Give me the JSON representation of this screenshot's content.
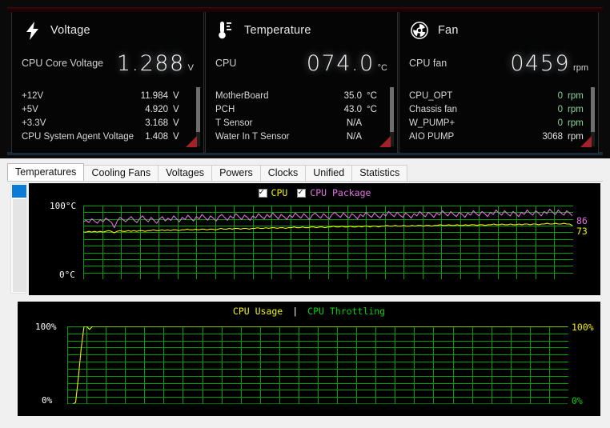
{
  "hw_monitor": {
    "panels": [
      {
        "id": "voltage",
        "icon": "lightning-bolt-icon",
        "title": "Voltage",
        "primary": {
          "label": "CPU Core Voltage",
          "value": "1.288",
          "unit": "V"
        },
        "rows": [
          {
            "name": "+12V",
            "value": "11.984",
            "unit": "V"
          },
          {
            "name": "+5V",
            "value": "4.920",
            "unit": "V"
          },
          {
            "name": "+3.3V",
            "value": "3.168",
            "unit": "V"
          },
          {
            "name": "CPU System Agent Voltage",
            "value": "1.408",
            "unit": "V"
          }
        ]
      },
      {
        "id": "temperature",
        "icon": "thermometer-icon",
        "title": "Temperature",
        "primary": {
          "label": "CPU",
          "value": "074.0",
          "unit": "°C"
        },
        "rows": [
          {
            "name": "MotherBoard",
            "value": "35.0",
            "unit": "°C"
          },
          {
            "name": "PCH",
            "value": "43.0",
            "unit": "°C"
          },
          {
            "name": "T Sensor",
            "value": "N/A",
            "unit": ""
          },
          {
            "name": "Water In T Sensor",
            "value": "N/A",
            "unit": ""
          }
        ]
      },
      {
        "id": "fan",
        "icon": "fan-icon",
        "title": "Fan",
        "primary": {
          "label": "CPU fan",
          "value": "0459",
          "unit": "rpm"
        },
        "rows": [
          {
            "name": "CPU_OPT",
            "value": "0",
            "unit": "rpm"
          },
          {
            "name": "Chassis fan",
            "value": "0",
            "unit": "rpm"
          },
          {
            "name": "W_PUMP+",
            "value": "0",
            "unit": "rpm"
          },
          {
            "name": "AIO PUMP",
            "value": "3068",
            "unit": "rpm"
          }
        ]
      }
    ]
  },
  "app": {
    "tabs": [
      {
        "label": "Temperatures",
        "active": true
      },
      {
        "label": "Cooling Fans",
        "active": false
      },
      {
        "label": "Voltages",
        "active": false
      },
      {
        "label": "Powers",
        "active": false
      },
      {
        "label": "Clocks",
        "active": false
      },
      {
        "label": "Unified",
        "active": false
      },
      {
        "label": "Statistics",
        "active": false
      }
    ],
    "scrollbar": {
      "name": "vertical-scrollbar"
    }
  },
  "colors": {
    "grid": "#00a000",
    "cpu_yellow": "#f2f200",
    "cpu_package_magenta": "#e36fe3",
    "throttle_green": "#00d000",
    "accent_blue": "#0a7bd6",
    "corner_red": "#a52129",
    "fan_value_green": "#87d5a2"
  },
  "chart_data": [
    {
      "type": "line",
      "title": "Temperatures",
      "id": "temperature-chart",
      "ylabel_top": "100°C",
      "ylabel_bottom": "0°C",
      "ylim": [
        0,
        100
      ],
      "grid": true,
      "legend": [
        {
          "label": "CPU",
          "color": "#f2f200",
          "checked": true
        },
        {
          "label": "CPU Package",
          "color": "#e36fe3",
          "checked": true
        }
      ],
      "right_labels": [
        {
          "text": "86",
          "color": "#e36fe3"
        },
        {
          "text": "73",
          "color": "#f2f200"
        }
      ],
      "series": [
        {
          "name": "CPU Package",
          "color": "#e36fe3",
          "current": 86,
          "values": [
            78,
            80,
            77,
            82,
            79,
            76,
            81,
            78,
            83,
            80,
            77,
            70,
            79,
            84,
            81,
            78,
            82,
            85,
            80,
            77,
            83,
            86,
            81,
            78,
            84,
            80,
            76,
            82,
            85,
            79,
            83,
            80,
            86,
            82,
            78,
            84,
            81,
            87,
            83,
            79,
            85,
            82,
            88,
            84,
            80,
            86,
            83,
            79,
            85,
            88,
            84,
            80,
            86,
            83,
            89,
            85,
            81,
            87,
            84,
            80,
            86,
            83,
            89,
            85,
            82,
            88,
            84,
            90,
            86,
            82,
            88,
            85,
            81,
            87,
            84,
            90,
            86,
            83,
            89,
            85,
            81,
            87,
            90,
            86,
            83,
            89,
            85,
            82,
            88,
            91,
            87,
            84,
            90,
            86,
            83,
            89,
            86,
            82,
            88,
            85,
            91,
            87,
            84,
            90,
            86,
            83,
            89,
            86,
            92,
            88,
            85,
            91,
            87,
            84,
            90,
            87,
            83,
            89,
            86,
            92,
            88,
            85,
            91,
            88,
            84,
            90,
            87,
            93,
            89,
            86,
            92,
            88,
            85,
            91,
            88,
            84,
            90,
            87,
            93,
            89,
            86,
            92,
            89,
            85,
            91,
            88,
            94,
            90,
            87,
            93,
            89,
            86,
            92,
            89,
            85,
            91,
            88,
            94,
            90,
            87,
            93,
            90,
            86,
            92,
            89,
            95,
            91,
            88,
            94,
            90,
            87,
            93,
            90,
            86
          ]
        },
        {
          "name": "CPU",
          "color": "#f2f200",
          "current": 73,
          "values": [
            64,
            64,
            65,
            64,
            65,
            64,
            65,
            64,
            65,
            66,
            65,
            63,
            65,
            66,
            65,
            65,
            66,
            65,
            66,
            65,
            66,
            66,
            65,
            66,
            66,
            67,
            66,
            66,
            67,
            66,
            67,
            66,
            67,
            67,
            66,
            67,
            67,
            68,
            67,
            67,
            68,
            67,
            68,
            68,
            67,
            68,
            68,
            67,
            68,
            69,
            68,
            68,
            69,
            68,
            69,
            69,
            68,
            69,
            69,
            68,
            69,
            69,
            70,
            69,
            69,
            70,
            69,
            70,
            70,
            69,
            70,
            70,
            69,
            70,
            70,
            71,
            70,
            70,
            71,
            70,
            70,
            71,
            71,
            70,
            71,
            71,
            70,
            71,
            71,
            72,
            71,
            71,
            72,
            71,
            71,
            72,
            71,
            71,
            72,
            71,
            72,
            72,
            71,
            72,
            72,
            71,
            72,
            72,
            73,
            72,
            72,
            73,
            72,
            72,
            73,
            72,
            72,
            73,
            72,
            73,
            73,
            72,
            73,
            73,
            72,
            73,
            73,
            74,
            73,
            73,
            74,
            73,
            73,
            74,
            73,
            73,
            74,
            73,
            74,
            74,
            73,
            74,
            74,
            73,
            74,
            74,
            75,
            74,
            74,
            75,
            74,
            74,
            75,
            74,
            74,
            75,
            74,
            75,
            75,
            74,
            75,
            75,
            74,
            75,
            75,
            76,
            75,
            75,
            76,
            75,
            75,
            76,
            75,
            75,
            73
          ]
        }
      ]
    },
    {
      "type": "line",
      "title": "CPU Usage",
      "id": "usage-chart",
      "ylabel_top": "100%",
      "ylabel_bottom": "0%",
      "ylim": [
        0,
        100
      ],
      "grid": true,
      "legend": [
        {
          "label": "CPU Usage",
          "color": "#f2f200"
        },
        {
          "label": "|",
          "color": "#ffffff"
        },
        {
          "label": "CPU Throttling",
          "color": "#00d000"
        }
      ],
      "right_labels": [
        {
          "text": "100%",
          "color": "#f2f200"
        },
        {
          "text": "0%",
          "color": "#00d000"
        }
      ],
      "series": [
        {
          "name": "CPU Usage",
          "color": "#f2f200",
          "current": 100,
          "values": [
            0,
            0,
            0,
            2,
            35,
            72,
            100,
            100,
            96,
            100,
            100,
            100,
            100,
            100,
            100,
            100,
            100,
            100,
            100,
            100,
            100,
            100,
            100,
            100,
            100,
            100,
            100,
            100,
            100,
            100,
            100,
            100,
            100,
            100,
            100,
            100,
            100,
            100,
            100,
            100,
            100,
            100,
            100,
            100,
            100,
            100,
            100,
            100,
            100,
            100,
            100,
            100,
            100,
            100,
            100,
            100,
            100,
            100,
            100,
            100,
            100,
            100,
            100,
            100,
            100,
            100,
            100,
            100,
            100,
            100,
            100,
            100,
            100,
            100,
            100,
            100,
            100,
            100,
            100,
            100,
            100,
            100,
            100,
            100,
            100,
            100,
            100,
            100,
            100,
            100,
            100,
            100,
            100,
            100,
            100,
            100,
            100,
            100,
            100,
            100,
            100,
            100,
            100,
            100,
            100,
            100,
            100,
            100,
            100,
            100,
            100,
            100,
            100,
            100,
            100,
            100,
            100,
            100,
            100,
            100,
            100,
            100,
            100,
            100,
            100,
            100,
            100,
            100,
            100,
            100,
            100,
            100,
            100,
            100,
            100,
            100,
            100,
            100,
            100,
            100,
            100,
            100,
            100,
            100,
            100,
            100,
            100,
            100,
            100,
            100,
            100,
            100,
            100,
            100,
            100,
            100,
            100,
            100,
            100,
            100,
            100,
            100,
            100,
            100,
            100,
            100,
            100,
            100,
            100,
            100,
            100,
            100,
            100,
            100,
            100,
            100,
            100,
            100,
            100,
            100
          ]
        },
        {
          "name": "CPU Throttling",
          "color": "#00d000",
          "current": 0,
          "values": [
            0,
            0,
            0,
            0,
            0,
            0,
            0,
            0,
            0,
            0,
            0,
            0,
            0,
            0,
            0,
            0,
            0,
            0,
            0,
            0,
            0,
            0,
            0,
            0,
            0,
            0,
            0,
            0,
            0,
            0,
            0,
            0,
            0,
            0,
            0,
            0,
            0,
            0,
            0,
            0,
            0,
            0,
            0,
            0,
            0,
            0,
            0,
            0,
            0,
            0,
            0,
            0,
            0,
            0,
            0,
            0,
            0,
            0,
            0,
            0,
            0,
            0,
            0,
            0,
            0,
            0,
            0,
            0,
            0,
            0,
            0,
            0,
            0,
            0,
            0,
            0,
            0,
            0,
            0,
            0,
            0,
            0,
            0,
            0,
            0,
            0,
            0,
            0,
            0,
            0,
            0,
            0,
            0,
            0,
            0,
            0,
            0,
            0,
            0,
            0,
            0,
            0,
            0,
            0,
            0,
            0,
            0,
            0,
            0,
            0,
            0,
            0,
            0,
            0,
            0,
            0,
            0,
            0,
            0,
            0,
            0,
            0,
            0,
            0,
            0,
            0,
            0,
            0,
            0,
            0,
            0,
            0,
            0,
            0,
            0,
            0,
            0,
            0,
            0,
            0,
            0,
            0,
            0,
            0,
            0,
            0,
            0,
            0,
            0,
            0,
            0,
            0,
            0,
            0,
            0,
            0,
            0,
            0,
            0,
            0,
            0,
            0,
            0,
            0,
            0,
            0,
            0,
            0,
            0,
            0,
            0,
            0,
            0,
            0,
            0,
            0,
            0,
            0,
            0,
            0
          ]
        }
      ]
    }
  ]
}
